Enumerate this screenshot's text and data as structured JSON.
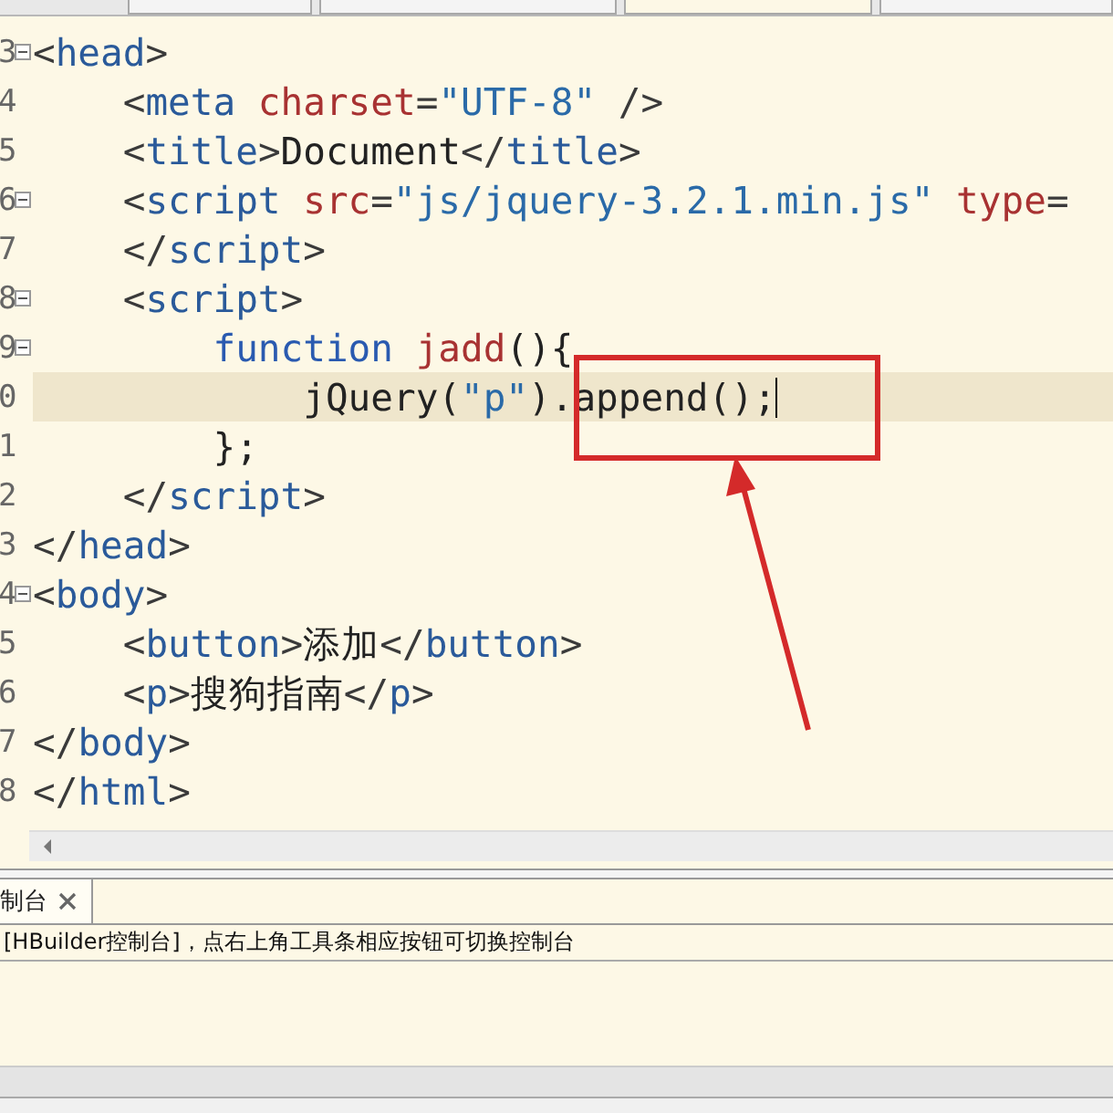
{
  "editor_tabs": [
    {
      "selected": false
    },
    {
      "selected": false
    },
    {
      "selected": true
    },
    {
      "selected": false
    }
  ],
  "lines": [
    {
      "number": "3",
      "fold": true,
      "current": false,
      "tokens": [
        {
          "kind": "punct",
          "text": "<"
        },
        {
          "kind": "tag",
          "text": "head"
        },
        {
          "kind": "punct",
          "text": ">"
        }
      ]
    },
    {
      "number": "4",
      "fold": false,
      "current": false,
      "tokens": [
        {
          "kind": "punct",
          "text": "    <"
        },
        {
          "kind": "tag",
          "text": "meta"
        },
        {
          "kind": "attr",
          "text": " charset"
        },
        {
          "kind": "punct",
          "text": "="
        },
        {
          "kind": "string",
          "text": "\"UTF-8\""
        },
        {
          "kind": "punct",
          "text": " />"
        }
      ]
    },
    {
      "number": "5",
      "fold": false,
      "current": false,
      "tokens": [
        {
          "kind": "punct",
          "text": "    <"
        },
        {
          "kind": "tag",
          "text": "title"
        },
        {
          "kind": "punct",
          "text": ">"
        },
        {
          "kind": "text",
          "text": "Document"
        },
        {
          "kind": "punct",
          "text": "</"
        },
        {
          "kind": "tag",
          "text": "title"
        },
        {
          "kind": "punct",
          "text": ">"
        }
      ]
    },
    {
      "number": "6",
      "fold": true,
      "current": false,
      "tokens": [
        {
          "kind": "punct",
          "text": "    <"
        },
        {
          "kind": "tag",
          "text": "script"
        },
        {
          "kind": "attr",
          "text": " src"
        },
        {
          "kind": "punct",
          "text": "="
        },
        {
          "kind": "string",
          "text": "\"js/jquery-3.2.1.min.js\""
        },
        {
          "kind": "attr",
          "text": " type"
        },
        {
          "kind": "punct",
          "text": "="
        }
      ]
    },
    {
      "number": "7",
      "fold": false,
      "current": false,
      "tokens": [
        {
          "kind": "punct",
          "text": "    </"
        },
        {
          "kind": "tag",
          "text": "script"
        },
        {
          "kind": "punct",
          "text": ">"
        }
      ]
    },
    {
      "number": "8",
      "fold": true,
      "current": false,
      "tokens": [
        {
          "kind": "punct",
          "text": "    <"
        },
        {
          "kind": "tag",
          "text": "script"
        },
        {
          "kind": "punct",
          "text": ">"
        }
      ]
    },
    {
      "number": "9",
      "fold": true,
      "current": false,
      "tokens": [
        {
          "kind": "keyword",
          "text": "        function"
        },
        {
          "kind": "name",
          "text": " jadd"
        },
        {
          "kind": "text",
          "text": "(){"
        }
      ]
    },
    {
      "number": "0",
      "fold": false,
      "current": true,
      "tokens": [
        {
          "kind": "text",
          "text": "            jQuery("
        },
        {
          "kind": "string",
          "text": "\"p\""
        },
        {
          "kind": "text",
          "text": ").append();"
        }
      ]
    },
    {
      "number": "1",
      "fold": false,
      "current": false,
      "tokens": [
        {
          "kind": "text",
          "text": "        };"
        }
      ]
    },
    {
      "number": "2",
      "fold": false,
      "current": false,
      "tokens": [
        {
          "kind": "punct",
          "text": "    </"
        },
        {
          "kind": "tag",
          "text": "script"
        },
        {
          "kind": "punct",
          "text": ">"
        }
      ]
    },
    {
      "number": "3",
      "fold": false,
      "current": false,
      "tokens": [
        {
          "kind": "punct",
          "text": "</"
        },
        {
          "kind": "tag",
          "text": "head"
        },
        {
          "kind": "punct",
          "text": ">"
        }
      ]
    },
    {
      "number": "4",
      "fold": true,
      "current": false,
      "tokens": [
        {
          "kind": "punct",
          "text": "<"
        },
        {
          "kind": "tag",
          "text": "body"
        },
        {
          "kind": "punct",
          "text": ">"
        }
      ]
    },
    {
      "number": "5",
      "fold": false,
      "current": false,
      "tokens": [
        {
          "kind": "punct",
          "text": "    <"
        },
        {
          "kind": "tag",
          "text": "button"
        },
        {
          "kind": "punct",
          "text": ">"
        },
        {
          "kind": "text",
          "text": "添加"
        },
        {
          "kind": "punct",
          "text": "</"
        },
        {
          "kind": "tag",
          "text": "button"
        },
        {
          "kind": "punct",
          "text": ">"
        }
      ]
    },
    {
      "number": "6",
      "fold": false,
      "current": false,
      "tokens": [
        {
          "kind": "punct",
          "text": "    <"
        },
        {
          "kind": "tag",
          "text": "p"
        },
        {
          "kind": "punct",
          "text": ">"
        },
        {
          "kind": "text",
          "text": "搜狗指南"
        },
        {
          "kind": "punct",
          "text": "</"
        },
        {
          "kind": "tag",
          "text": "p"
        },
        {
          "kind": "punct",
          "text": ">"
        }
      ]
    },
    {
      "number": "7",
      "fold": false,
      "current": false,
      "tokens": [
        {
          "kind": "punct",
          "text": "</"
        },
        {
          "kind": "tag",
          "text": "body"
        },
        {
          "kind": "punct",
          "text": ">"
        }
      ]
    },
    {
      "number": "8",
      "fold": false,
      "current": false,
      "tokens": [
        {
          "kind": "punct",
          "text": "</"
        },
        {
          "kind": "tag",
          "text": "html"
        },
        {
          "kind": "punct",
          "text": ">"
        }
      ]
    }
  ],
  "console": {
    "tab": {
      "label": "制台",
      "selected": true
    },
    "message": "[HBuilder控制台]，点右上角工具条相应按钮可切换控制台"
  }
}
